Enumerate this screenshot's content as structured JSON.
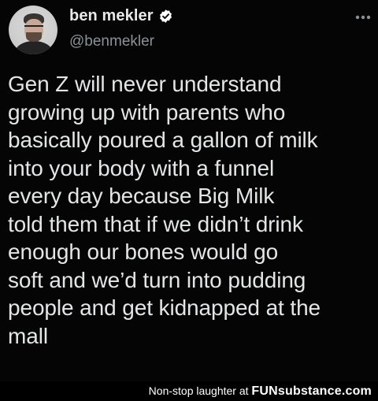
{
  "tweet": {
    "display_name": "ben mekler",
    "handle": "@benmekler",
    "verified_icon": "verified-badge-icon",
    "more_icon": "more-options-icon",
    "text": "Gen Z will never understand\ngrowing up with parents who\nbasically poured a gallon of milk\ninto your body with a funnel\nevery day because Big Milk\ntold them that if we didn’t drink\nenough our bones would go\nsoft and we’d turn into pudding\npeople and get kidnapped at the\nmall"
  },
  "footer": {
    "watermark_prefix": "Non-stop laughter at ",
    "watermark_brand": "FUNsubstance.com"
  },
  "colors": {
    "background": "#000000",
    "text": "#e7e9ea",
    "handle": "#8b9197"
  }
}
